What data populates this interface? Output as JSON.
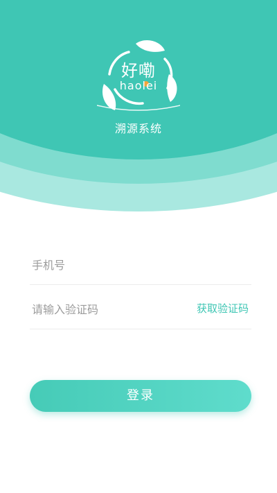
{
  "header": {
    "logo_text": "好嘞",
    "logo_subtext": "haolei",
    "app_title": "溯源系统"
  },
  "form": {
    "phone_placeholder": "手机号",
    "code_placeholder": "请输入验证码",
    "get_code_label": "获取验证码",
    "login_label": "登录"
  },
  "colors": {
    "brand": "#3fc6b4",
    "brand_light": "#7fdccf",
    "brand_pale": "#a9e8e0"
  },
  "icons": [
    "leaf-ring-logo-icon"
  ]
}
